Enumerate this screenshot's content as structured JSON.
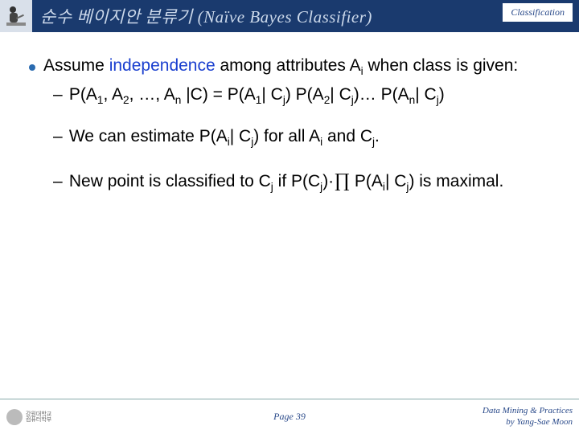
{
  "header": {
    "title": "순수 베이지안 분류기 (Naïve Bayes Classifier)",
    "chapter": "Classification",
    "icon": "person-writing-icon"
  },
  "body": {
    "bullet_prefix": "Assume ",
    "bullet_highlight": "independence",
    "bullet_suffix": " among attributes A",
    "bullet_sub": "i",
    "bullet_end": " when class is given:",
    "eq1_a": "P(A",
    "eq1_b": ", A",
    "eq1_c": ", …, A",
    "eq1_d": " |C) = P(A",
    "eq1_e": "| C",
    "eq1_f": ") P(A",
    "eq1_g": "| C",
    "eq1_h": ")… P(A",
    "eq1_i": "| C",
    "eq1_j": ")",
    "line2_a": "We can estimate P(A",
    "line2_b": "| C",
    "line2_c": ") for all A",
    "line2_d": " and C",
    "line2_e": ".",
    "line3_a": "New point is classified to C",
    "line3_b": " if  P(C",
    "line3_c": ")·",
    "line3_pi": "∏",
    "line3_d": " P(A",
    "line3_e": "| C",
    "line3_f": ")  is maximal.",
    "s1": "1",
    "s2": "2",
    "sn": "n",
    "si": "i",
    "sj": "j"
  },
  "footer": {
    "page": "Page 39",
    "right1": "Data Mining & Practices",
    "right2": "by Yang-Sae Moon",
    "logo1": "강원대학교",
    "logo2": "컴퓨터학부"
  }
}
